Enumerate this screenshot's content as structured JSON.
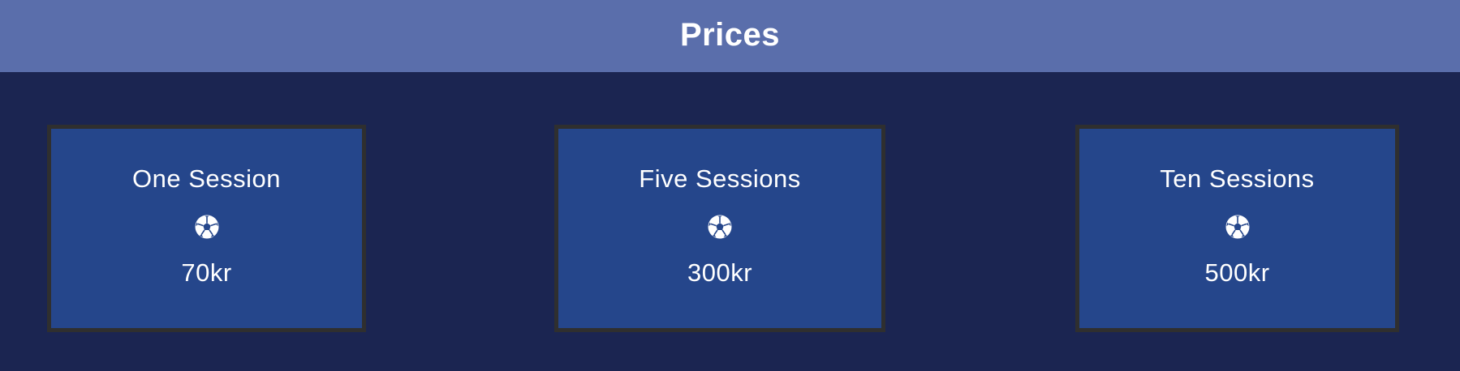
{
  "header": {
    "title": "Prices",
    "background": "#5a6eab"
  },
  "page": {
    "background": "#1b2551"
  },
  "cards": [
    {
      "title": "One Session",
      "icon": "soccer-ball-icon",
      "price": "70kr"
    },
    {
      "title": "Five Sessions",
      "icon": "soccer-ball-icon",
      "price": "300kr"
    },
    {
      "title": "Ten Sessions",
      "icon": "soccer-ball-icon",
      "price": "500kr"
    }
  ],
  "card_style": {
    "background": "#25468b",
    "border": "#2f2f2f"
  }
}
